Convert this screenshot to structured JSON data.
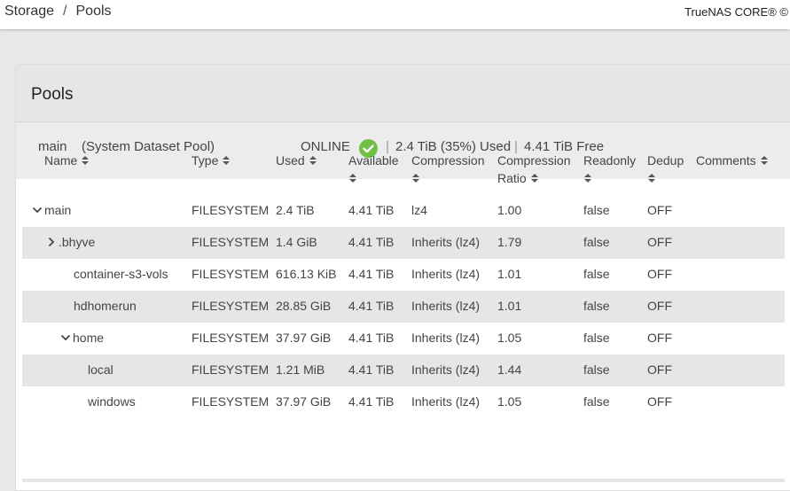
{
  "breadcrumb": {
    "items": [
      "Storage",
      "Pools"
    ],
    "separator": "/"
  },
  "brand": "TrueNAS CORE® ©",
  "card": {
    "title": "Pools"
  },
  "pool": {
    "name": "main",
    "description": "(System Dataset Pool)",
    "status": "ONLINE",
    "used": "2.4 TiB (35%) Used",
    "free": "4.41 TiB Free",
    "status_color": "#71bf44"
  },
  "table": {
    "headers": {
      "name": "Name",
      "type": "Type",
      "used": "Used",
      "available": "Available",
      "compression": "Compression",
      "compression_ratio_1": "Compression",
      "compression_ratio_2": "Ratio",
      "readonly": "Readonly",
      "dedup": "Dedup",
      "comments": "Comments"
    },
    "rows": [
      {
        "name": "main",
        "chevron": "down",
        "level": 0,
        "type": "FILESYSTEM",
        "used": "2.4 TiB",
        "available": "4.41 TiB",
        "compression": "lz4",
        "ratio": "1.00",
        "readonly": "false",
        "dedup": "OFF"
      },
      {
        "name": ".bhyve",
        "chevron": "right",
        "level": 1,
        "type": "FILESYSTEM",
        "used": "1.4 GiB",
        "available": "4.41 TiB",
        "compression": "Inherits (lz4)",
        "ratio": "1.79",
        "readonly": "false",
        "dedup": "OFF"
      },
      {
        "name": "container-s3-vols",
        "chevron": "none",
        "level": 1,
        "type": "FILESYSTEM",
        "used": "616.13 KiB",
        "available": "4.41 TiB",
        "compression": "Inherits (lz4)",
        "ratio": "1.01",
        "readonly": "false",
        "dedup": "OFF"
      },
      {
        "name": "hdhomerun",
        "chevron": "none",
        "level": 1,
        "type": "FILESYSTEM",
        "used": "28.85 GiB",
        "available": "4.41 TiB",
        "compression": "Inherits (lz4)",
        "ratio": "1.01",
        "readonly": "false",
        "dedup": "OFF"
      },
      {
        "name": "home",
        "chevron": "down",
        "level": 1,
        "type": "FILESYSTEM",
        "used": "37.97 GiB",
        "available": "4.41 TiB",
        "compression": "Inherits (lz4)",
        "ratio": "1.05",
        "readonly": "false",
        "dedup": "OFF"
      },
      {
        "name": "local",
        "chevron": "none",
        "level": 2,
        "type": "FILESYSTEM",
        "used": "1.21 MiB",
        "available": "4.41 TiB",
        "compression": "Inherits (lz4)",
        "ratio": "1.44",
        "readonly": "false",
        "dedup": "OFF"
      },
      {
        "name": "windows",
        "chevron": "none",
        "level": 2,
        "type": "FILESYSTEM",
        "used": "37.97 GiB",
        "available": "4.41 TiB",
        "compression": "Inherits (lz4)",
        "ratio": "1.05",
        "readonly": "false",
        "dedup": "OFF"
      }
    ]
  }
}
